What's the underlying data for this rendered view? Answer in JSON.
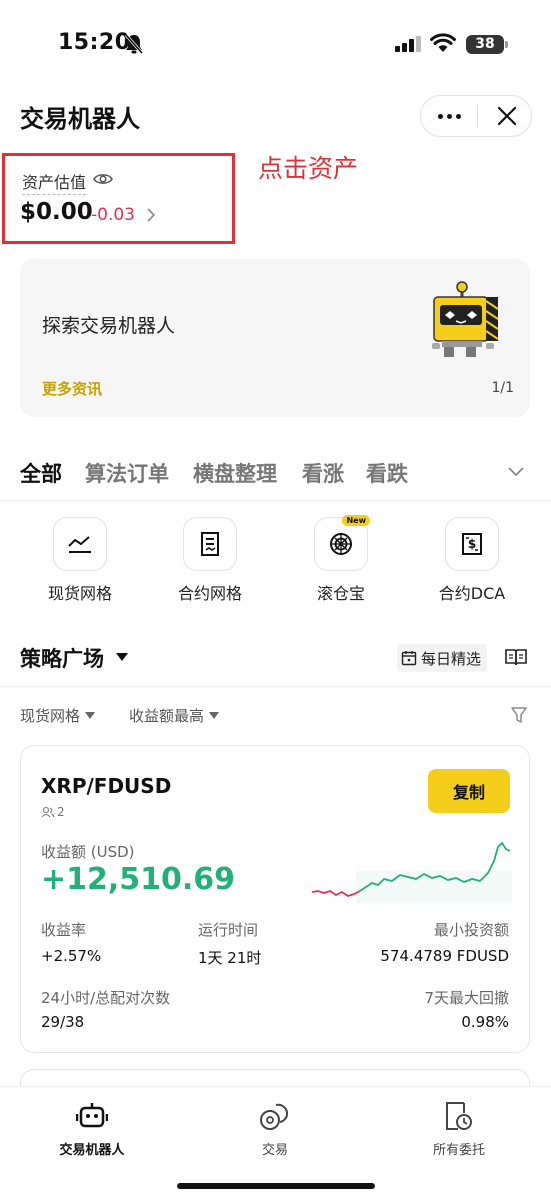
{
  "status_bar": {
    "time": "15:20",
    "battery": "38"
  },
  "header": {
    "title": "交易机器人"
  },
  "asset": {
    "label": "资产估值",
    "value": "$0.00",
    "change": "-0.03"
  },
  "annotation": "点击资产",
  "banner": {
    "title": "探索交易机器人",
    "link": "更多资讯",
    "page": "1/1"
  },
  "tabs": [
    "全部",
    "算法订单",
    "横盘整理",
    "看涨",
    "看跌"
  ],
  "strategies": [
    {
      "label": "现货网格",
      "icon": "spot-grid-icon"
    },
    {
      "label": "合约网格",
      "icon": "futures-grid-icon"
    },
    {
      "label": "滚仓宝",
      "icon": "rollover-icon",
      "badge": "New"
    },
    {
      "label": "合约DCA",
      "icon": "futures-dca-icon"
    }
  ],
  "plaza": {
    "title": "策略广场",
    "daily": "每日精选",
    "filters": [
      "现货网格",
      "收益额最高"
    ]
  },
  "card": {
    "pair": "XRP/FDUSD",
    "users": "2",
    "copy_label": "复制",
    "pnl_label": "收益额 (USD)",
    "pnl_value": "+12,510.69",
    "roi_label": "收益率",
    "roi_value": "+2.57%",
    "runtime_label": "运行时间",
    "runtime_value": "1天 21时",
    "min_invest_label": "最小投资额",
    "min_invest_value": "574.4789 FDUSD",
    "trades_label": "24小时/总配对次数",
    "trades_value": "29/38",
    "drawdown_label": "7天最大回撤",
    "drawdown_value": "0.98%",
    "colors": {
      "positive": "#22b07a",
      "negative": "#e0305a"
    }
  },
  "bottom_nav": [
    {
      "label": "交易机器人",
      "icon": "robot-icon",
      "active": true
    },
    {
      "label": "交易",
      "icon": "trade-icon",
      "active": false
    },
    {
      "label": "所有委托",
      "icon": "orders-icon",
      "active": false
    }
  ],
  "colors": {
    "accent": "#f5cd1b",
    "annotation": "#e0303a"
  }
}
